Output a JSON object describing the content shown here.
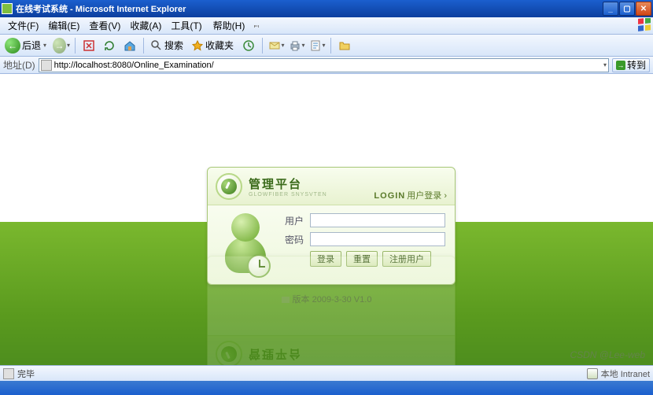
{
  "window": {
    "title": "在线考试系统 - Microsoft Internet Explorer"
  },
  "menus": {
    "file": "文件(F)",
    "edit": "编辑(E)",
    "view": "查看(V)",
    "fav": "收藏(A)",
    "tools": "工具(T)",
    "help": "帮助(H)",
    "hint": ""
  },
  "toolbar": {
    "back": "后退",
    "search": "搜索",
    "fav": "收藏夹"
  },
  "address": {
    "label": "地址(D)",
    "url": "http://localhost:8080/Online_Examination/",
    "go": "转到"
  },
  "card": {
    "title": "管理平台",
    "subtitle": "GLOWFIBER SNYSVTEN",
    "login_en": "LOGIN",
    "login_cn": "用户登录",
    "user_label": "用户",
    "pass_label": "密码",
    "user_value": "",
    "pass_value": "",
    "btn_login": "登录",
    "btn_reset": "重置",
    "btn_register": "注册用户"
  },
  "version": "版本 2009-3-30 V1.0",
  "status": {
    "left": "完毕",
    "right": "本地 Intranet"
  },
  "watermark": "CSDN @Lee-web"
}
